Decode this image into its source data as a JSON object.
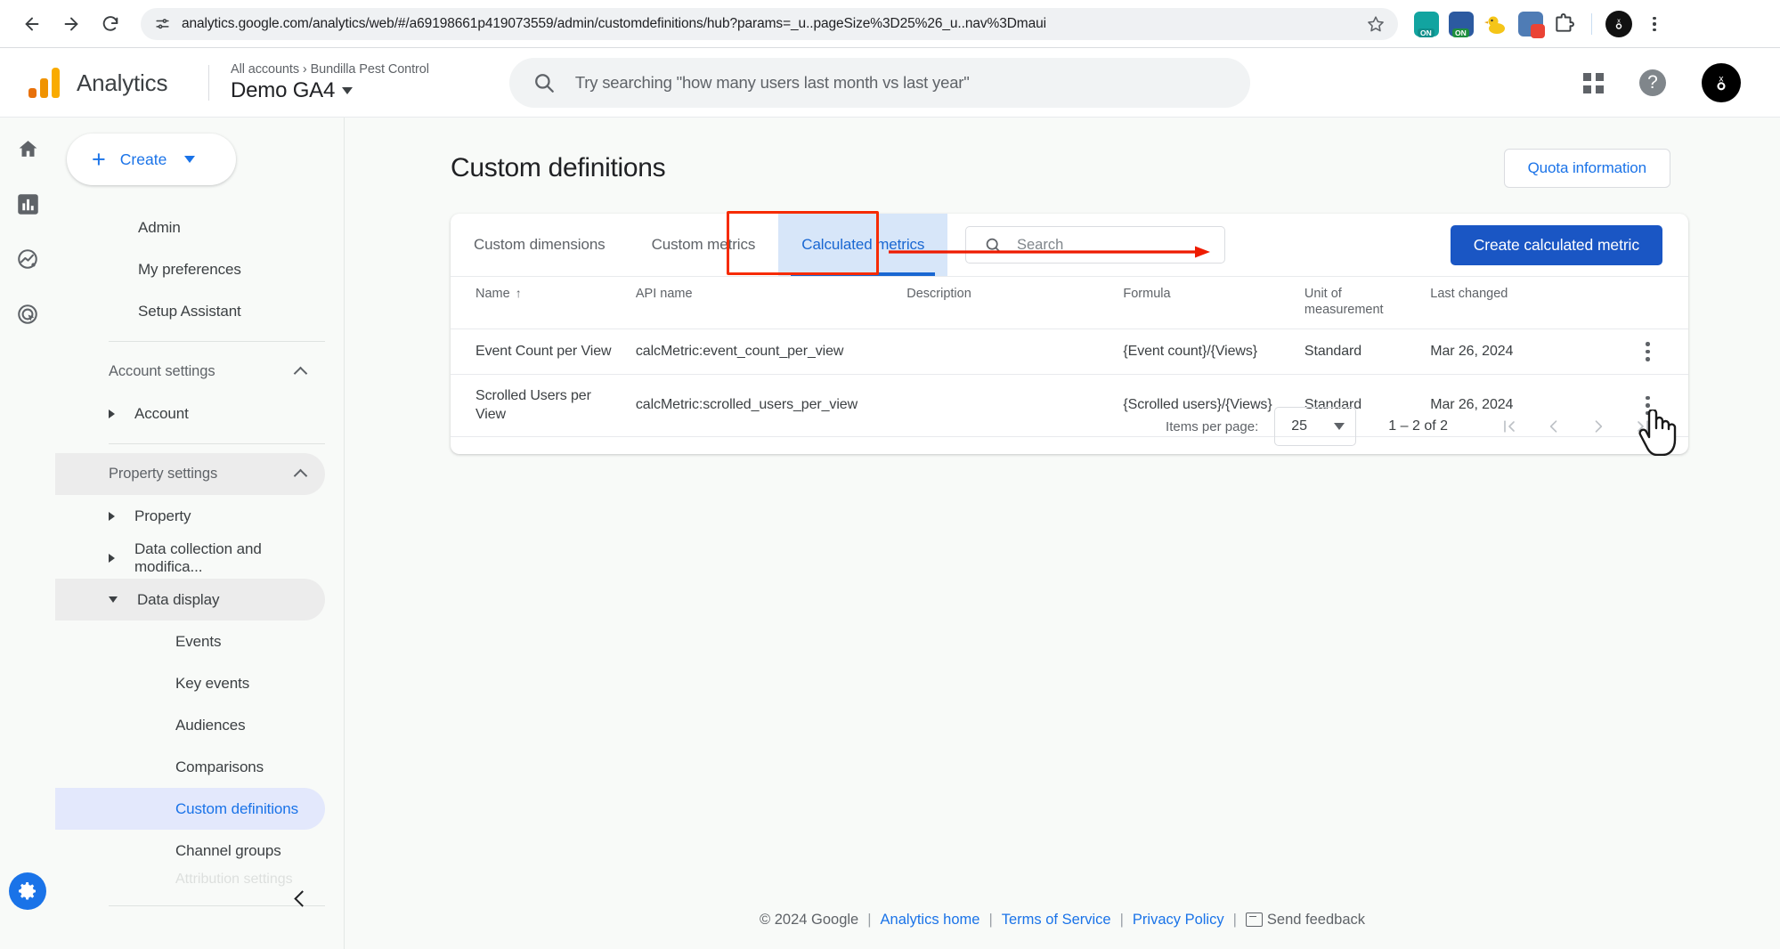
{
  "browser": {
    "url": "analytics.google.com/analytics/web/#/a69198661p419073559/admin/customdefinitions/hub?params=_u..pageSize%3D25%26_u..nav%3Dmaui",
    "back_icon": "back-arrow-icon",
    "forward_icon": "forward-arrow-icon",
    "reload_icon": "reload-icon",
    "site_info_icon": "site-settings-icon",
    "bookmark_icon": "star-icon",
    "extensions": [
      {
        "name": "extension-teal-on",
        "badge": "ON",
        "color": "#12a4a0",
        "badge_color": "#0f8f8b"
      },
      {
        "name": "extension-green-on",
        "badge": "ON",
        "color": "#2c5aa0",
        "badge_color": "#1e8e3e"
      },
      {
        "name": "extension-duck",
        "badge": "",
        "color": "#f5c518",
        "badge_color": ""
      },
      {
        "name": "extension-red-dot",
        "badge": "",
        "color": "#4f7cb5",
        "badge_color": "#ea4335"
      }
    ],
    "puzzle_icon": "extensions-puzzle-icon",
    "profile_icon": "profile-avatar-icon",
    "menu_icon": "chrome-menu-icon"
  },
  "ga_header": {
    "product_name": "Analytics",
    "logo_icon": "analytics-logo-icon",
    "breadcrumb": "All accounts  ›  Bundilla Pest Control",
    "property_name": "Demo GA4",
    "property_caret_icon": "chevron-down-icon",
    "search_placeholder": "Try searching \"how many users last month vs last year\"",
    "search_icon": "search-icon",
    "apps_icon": "apps-grid-icon",
    "help_icon": "help-icon",
    "avatar_icon": "user-avatar-icon"
  },
  "rail": {
    "items": [
      {
        "name": "rail-item-home",
        "icon": "home-icon"
      },
      {
        "name": "rail-item-reports",
        "icon": "bar-chart-icon"
      },
      {
        "name": "rail-item-explore",
        "icon": "explore-compass-icon"
      },
      {
        "name": "rail-item-advertising",
        "icon": "advertising-target-icon"
      }
    ],
    "gear_icon": "settings-gear-icon"
  },
  "sidebar": {
    "create_label": "Create",
    "create_plus": "+",
    "items": [
      {
        "label": "Admin",
        "type": "link",
        "state": "normal"
      },
      {
        "label": "My preferences",
        "type": "link",
        "state": "normal"
      },
      {
        "label": "Setup Assistant",
        "type": "link",
        "state": "normal"
      },
      {
        "label": "Account settings",
        "type": "group",
        "state": "expanded"
      },
      {
        "label": "Account",
        "type": "expandable",
        "state": "collapsed"
      },
      {
        "label": "Property settings",
        "type": "group",
        "state": "expanded"
      },
      {
        "label": "Property",
        "type": "expandable",
        "state": "collapsed"
      },
      {
        "label": "Data collection and modifica...",
        "type": "expandable",
        "state": "collapsed"
      },
      {
        "label": "Data display",
        "type": "expandable",
        "state": "expanded"
      },
      {
        "label": "Events",
        "type": "child",
        "state": "normal"
      },
      {
        "label": "Key events",
        "type": "child",
        "state": "normal"
      },
      {
        "label": "Audiences",
        "type": "child",
        "state": "normal"
      },
      {
        "label": "Comparisons",
        "type": "child",
        "state": "normal"
      },
      {
        "label": "Custom definitions",
        "type": "child",
        "state": "active"
      },
      {
        "label": "Channel groups",
        "type": "child",
        "state": "normal"
      },
      {
        "label": "Attribution settings",
        "type": "child",
        "state": "cut-off"
      }
    ],
    "collapse_icon": "chevron-left-icon"
  },
  "main": {
    "page_title": "Custom definitions",
    "quota_button": "Quota information",
    "tabs": [
      {
        "label": "Custom dimensions",
        "selected": false
      },
      {
        "label": "Custom metrics",
        "selected": false
      },
      {
        "label": "Calculated metrics",
        "selected": true
      }
    ],
    "search_placeholder": "Search",
    "search_icon": "search-icon",
    "create_button": "Create calculated metric",
    "annotation": {
      "highlight_color": "#f62b00",
      "arrow_color": "#ee1b00"
    },
    "table": {
      "headers": [
        "Name",
        "API name",
        "Description",
        "Formula",
        "Unit of measurement",
        "Last changed"
      ],
      "sort_column": "Name",
      "sort_arrow": "↑",
      "rows": [
        {
          "name": "Event Count per View",
          "api_name": "calcMetric:event_count_per_view",
          "description": "",
          "formula": "{Event count}/{Views}",
          "unit": "Standard",
          "last_changed": "Mar 26, 2024",
          "menu_icon": "row-more-options-icon"
        },
        {
          "name": "Scrolled Users per View",
          "api_name": "calcMetric:scrolled_users_per_view",
          "description": "",
          "formula": "{Scrolled users}/{Views}",
          "unit": "Standard",
          "last_changed": "Mar 26, 2024",
          "menu_icon": "row-more-options-icon"
        }
      ]
    },
    "paginator": {
      "items_per_page_label": "Items per page:",
      "items_per_page_value": "25",
      "range_label": "1 – 2 of 2",
      "first_icon": "first-page-icon",
      "prev_icon": "previous-page-icon",
      "next_icon": "next-page-icon",
      "last_icon": "last-page-icon"
    }
  },
  "footer": {
    "copyright": "© 2024 Google",
    "sep": "|",
    "links": [
      "Analytics home",
      "Terms of Service",
      "Privacy Policy"
    ],
    "feedback": "Send feedback",
    "feedback_icon": "feedback-icon"
  }
}
